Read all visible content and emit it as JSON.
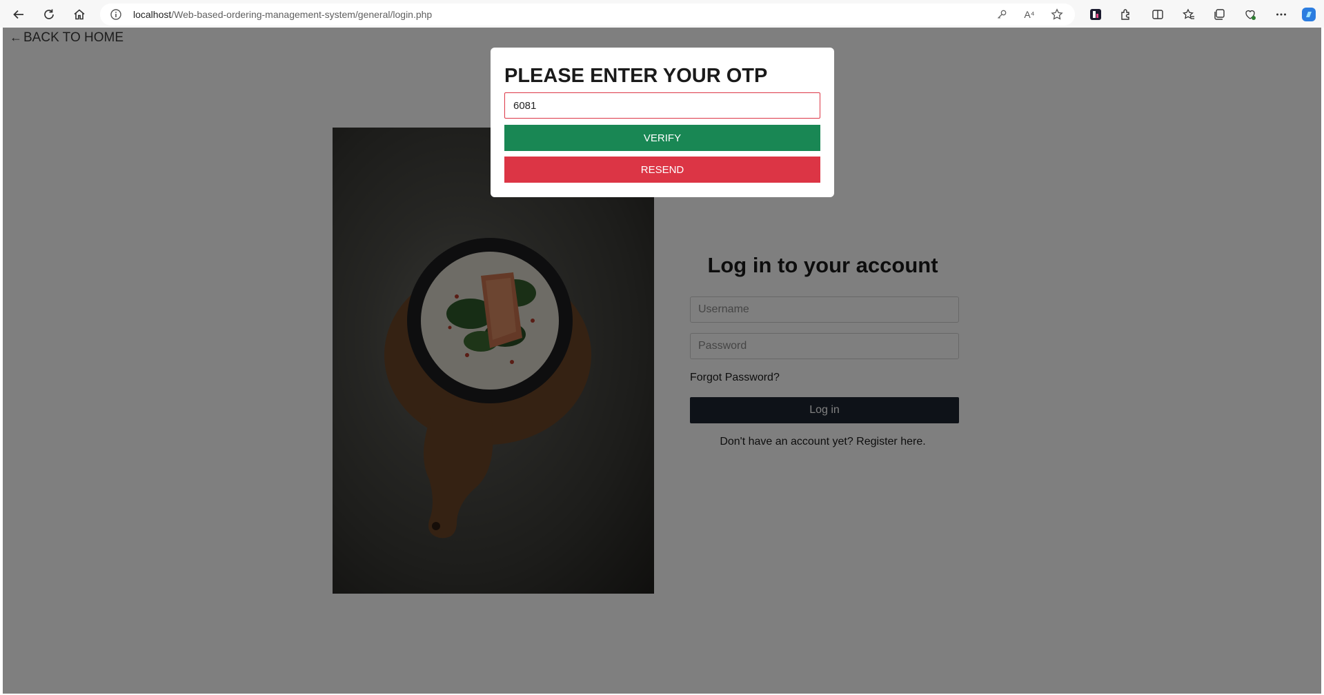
{
  "browser": {
    "url_host": "localhost",
    "url_path": "/Web-based-ordering-management-system/general/login.php",
    "icons": [
      "back-icon",
      "refresh-icon",
      "home-icon",
      "info-icon",
      "key-icon",
      "read-aloud-icon",
      "favorite-star-icon",
      "extension-b-icon",
      "puzzle-icon",
      "split-screen-icon",
      "favorites-icon",
      "collections-icon",
      "performance-icon",
      "more-icon",
      "copilot-icon"
    ],
    "read_aloud_glyph": "A⁴"
  },
  "page": {
    "back_arrow": "←",
    "back_link": "BACK TO HOME"
  },
  "login": {
    "title": "Log in to your account",
    "username_placeholder": "Username",
    "password_placeholder": "Password",
    "forgot_password": "Forgot Password?",
    "login_button": "Log in",
    "register_text": "Don't have an account yet? Register here."
  },
  "otp_modal": {
    "title": "PLEASE ENTER YOUR OTP",
    "otp_value": "6081",
    "verify_label": "VERIFY",
    "resend_label": "RESEND"
  },
  "colors": {
    "verify": "#198754",
    "resend": "#dc3545",
    "login_button": "#1c2530",
    "overlay": "rgba(0,0,0,0.5)"
  }
}
